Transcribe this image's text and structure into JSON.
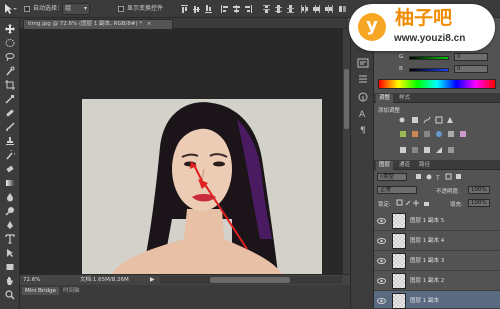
{
  "options_bar": {
    "auto_select_label": "自动选择：",
    "auto_select_value": "组",
    "show_transform_label": "显示变换控件"
  },
  "document": {
    "tab_title": "timg.jpg @ 72.6% (图层 1 副本, RGB/8#) *",
    "tab_close": "×",
    "zoom": "72.6%",
    "doc_info": "文档:1.65M/8.26M"
  },
  "bottom_tabs": [
    "Mini Bridge",
    "时间轴"
  ],
  "logo": {
    "title": "柚子吧",
    "url": "www.youzi8.cn",
    "badge_letter": "y"
  },
  "color_panel": {
    "rows": [
      {
        "label": "G",
        "value": "0"
      },
      {
        "label": "B",
        "value": "0"
      }
    ]
  },
  "adjustments_panel": {
    "tabs": [
      "调整",
      "样式"
    ],
    "heading": "添加调整"
  },
  "layers_panel": {
    "tabs": [
      "图层",
      "通道",
      "路径"
    ],
    "filter_kind": "类型",
    "blend_mode": "正常",
    "opacity_label": "不透明度:",
    "opacity_value": "100%",
    "lock_label": "锁定:",
    "fill_label": "填充:",
    "fill_value": "100%",
    "layers": [
      {
        "name": "图层 1 副本 5",
        "selected": false
      },
      {
        "name": "图层 1 副本 4",
        "selected": false
      },
      {
        "name": "图层 1 副本 3",
        "selected": false
      },
      {
        "name": "图层 1 副本 2",
        "selected": false
      },
      {
        "name": "图层 1 副本",
        "selected": true
      }
    ]
  },
  "colors": {
    "ui_dark": "#3b3b3b",
    "ui_mid": "#535353",
    "canvas_bg": "#282828",
    "selection": "#5a6a80",
    "logo_orange": "#f08c00",
    "annotation_red": "#e02020"
  }
}
